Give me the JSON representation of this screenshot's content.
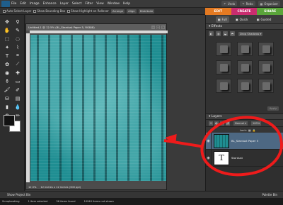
{
  "menubar": {
    "items": [
      "File",
      "Edit",
      "Image",
      "Enhance",
      "Layer",
      "Select",
      "Filter",
      "View",
      "Window",
      "Help"
    ],
    "right": {
      "undo": "Undo",
      "redo": "Redo",
      "organizer": "Organizer"
    }
  },
  "options": {
    "auto_select": "Auto Select Layer",
    "bounding": "Show Bounding Box",
    "highlight": "Show Highlight on Rollover",
    "arrange": "Arrange",
    "align": "Align",
    "distribute": "Distribute"
  },
  "tabs": {
    "edit": "EDIT",
    "create": "CREATE",
    "share": "SHARE"
  },
  "document": {
    "title": "Untitled-1 @ 12.5% (BL_Stardust Paper 5, RGB/8)",
    "zoom": "12.5%",
    "size": "12 inches x 12 inches (300 ppi)"
  },
  "modes": {
    "full": "Full",
    "quick": "Quick",
    "guided": "Guided"
  },
  "effects": {
    "title": "Effects",
    "dropdown": "Drop Shadows",
    "apply": "Apply"
  },
  "layers": {
    "title": "Layers",
    "blend": "Normal",
    "opacity": "100%",
    "lock": "Lock:",
    "rows": [
      {
        "name": "BL_Stardust Paper 5"
      },
      {
        "name": "Stardust"
      }
    ]
  },
  "project_bin": {
    "show": "Show Project Bin",
    "palette": "Palette Bin"
  },
  "taskbar": {
    "status": "Scrapbooking",
    "selected": "1 item selected",
    "found": "36 items found",
    "hidden": "10940 items not shown"
  },
  "colors": {
    "annotation": "#ee1b1b",
    "edit_tab": "#e47a22",
    "create_tab": "#c92d6f",
    "share_tab": "#5aa53a",
    "paper": "#1f8e92"
  }
}
